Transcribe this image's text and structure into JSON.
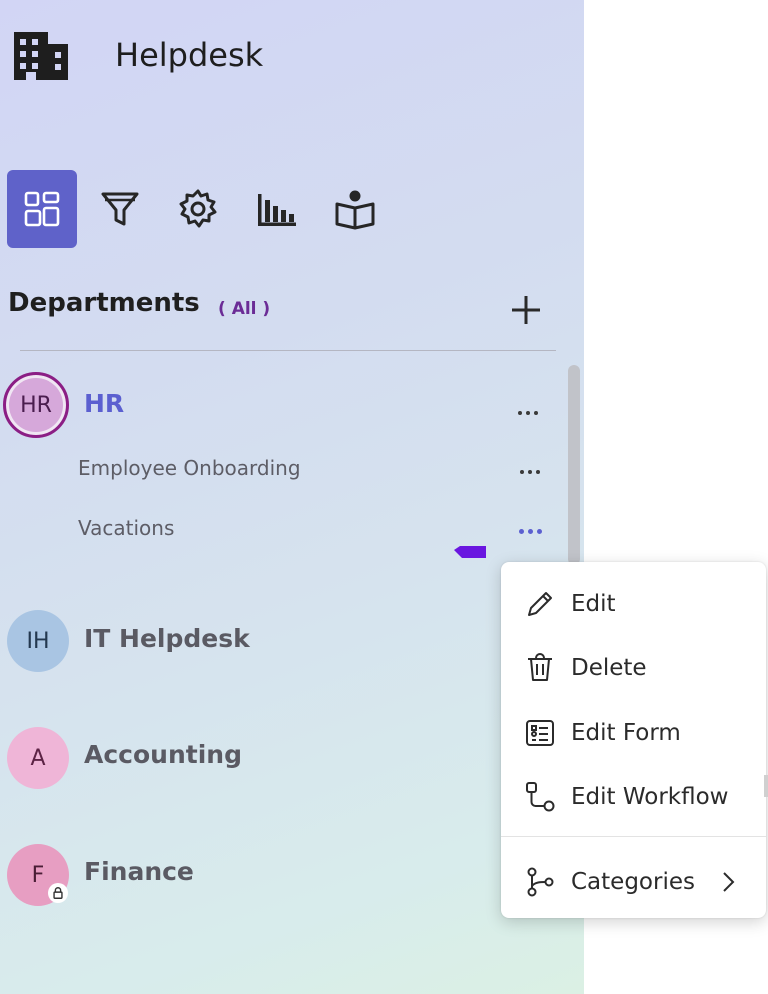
{
  "app": {
    "title": "Helpdesk",
    "logo_icon": "building-icon"
  },
  "toolbar": {
    "items": [
      {
        "name": "dashboard",
        "icon": "grid-layout-icon",
        "active": true
      },
      {
        "name": "filter",
        "icon": "funnel-icon",
        "active": false
      },
      {
        "name": "settings",
        "icon": "gear-icon",
        "active": false
      },
      {
        "name": "reports",
        "icon": "bar-chart-icon",
        "active": false
      },
      {
        "name": "knowledge",
        "icon": "reader-book-icon",
        "active": false
      }
    ],
    "active_color": "#5f62c9"
  },
  "departments": {
    "heading": "Departments",
    "filter_label": "( All )",
    "add_icon": "plus-icon",
    "items": [
      {
        "initials": "HR",
        "name": "HR",
        "selected": true,
        "children": [
          {
            "name": "Employee Onboarding"
          },
          {
            "name": "Vacations"
          }
        ]
      },
      {
        "initials": "IH",
        "name": "IT Helpdesk"
      },
      {
        "initials": "A",
        "name": "Accounting"
      },
      {
        "initials": "F",
        "name": "Finance",
        "locked": true
      }
    ]
  },
  "context_menu": {
    "items": [
      {
        "label": "Edit",
        "icon": "pencil-icon"
      },
      {
        "label": "Delete",
        "icon": "trash-icon"
      },
      {
        "label": "Edit Form",
        "icon": "form-icon"
      },
      {
        "label": "Edit Workflow",
        "icon": "workflow-icon"
      },
      {
        "label": "Categories",
        "icon": "branch-icon",
        "submenu": true
      }
    ]
  },
  "colors": {
    "accent": "#5b5fd0",
    "hr_ring": "#8b1e85",
    "filter_text": "#6b2c96"
  }
}
